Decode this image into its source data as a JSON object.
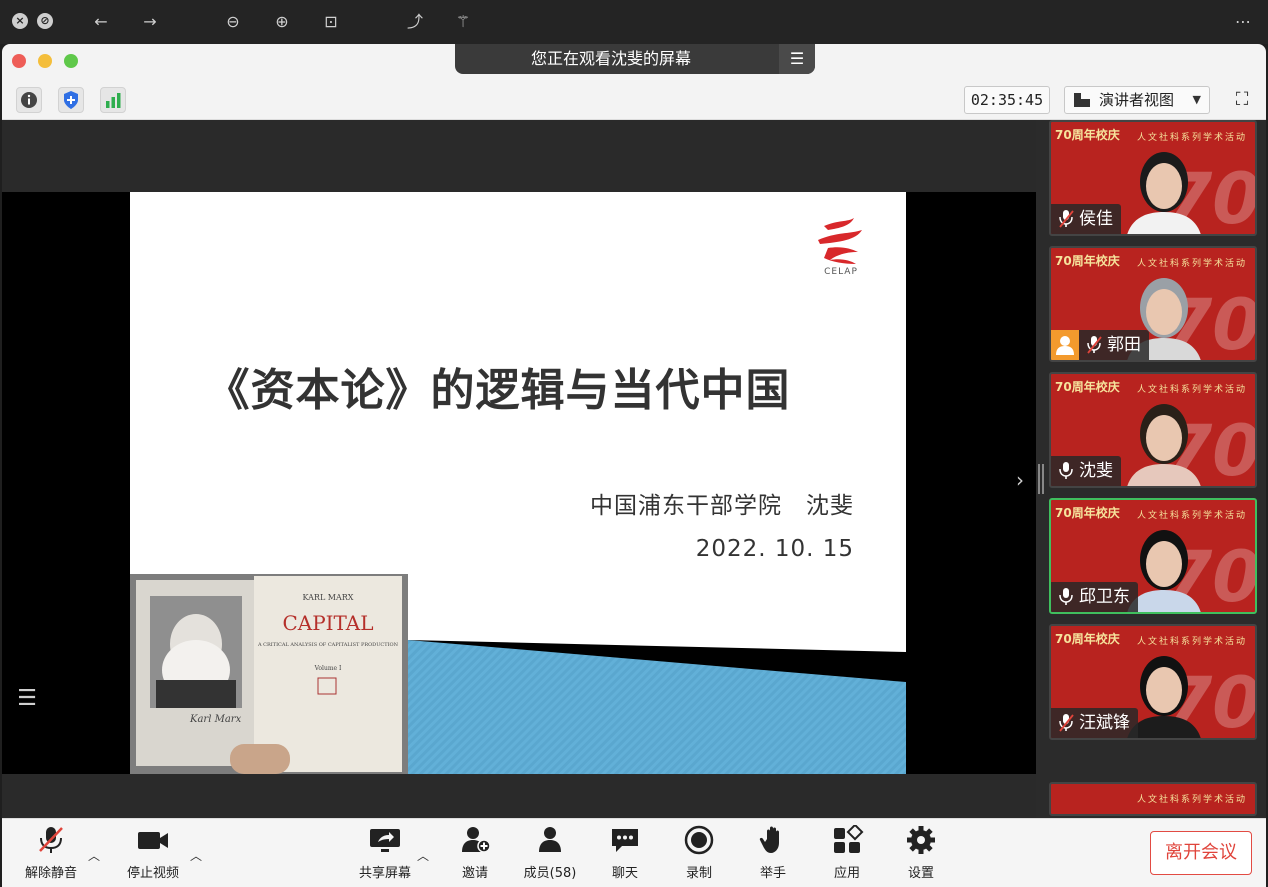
{
  "share_banner": {
    "text": "您正在观看沈斐的屏幕"
  },
  "status": {
    "timer": "02:35:45",
    "view_mode": "演讲者视图"
  },
  "slide": {
    "title": "《资本论》的逻辑与当代中国",
    "author": "中国浦东干部学院　沈斐",
    "date": "2022. 10. 15",
    "logo_text": "CELAP"
  },
  "book": {
    "author": "KARL MARX",
    "title": "CAPITAL",
    "subtitle": "A CRITICAL ANALYSIS OF CAPITALIST PRODUCTION",
    "volume": "Volume I"
  },
  "participants": [
    {
      "name": "侯佳",
      "muted": true,
      "active": false
    },
    {
      "name": "郭田",
      "muted": true,
      "active": false
    },
    {
      "name": "沈斐",
      "muted": false,
      "active": false
    },
    {
      "name": "邱卫东",
      "muted": false,
      "active": true
    },
    {
      "name": "汪斌锋",
      "muted": true,
      "active": false
    }
  ],
  "tile_background": {
    "badge": "70周年校庆",
    "banner": "人文社科系列学术活动",
    "number": "70"
  },
  "controls": {
    "unmute": "解除静音",
    "stop_video": "停止视频",
    "share_screen": "共享屏幕",
    "invite": "邀请",
    "members": "成员(58)",
    "chat": "聊天",
    "record": "录制",
    "raise_hand": "举手",
    "apps": "应用",
    "settings": "设置",
    "leave": "离开会议"
  },
  "colors": {
    "tile_red": "#b8231f",
    "active_border": "#3fbf5e",
    "leave_red": "#e0443b"
  }
}
